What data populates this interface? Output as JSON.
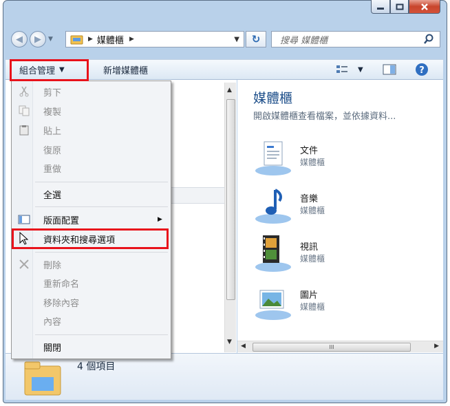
{
  "address": {
    "crumb": "媒體櫃"
  },
  "search": {
    "placeholder": "搜尋 媒體櫃"
  },
  "toolbar": {
    "organize": "組合管理",
    "new_library": "新增媒體櫃"
  },
  "menu": {
    "items": [
      {
        "label": "剪下",
        "enabled": false
      },
      {
        "label": "複製",
        "enabled": false
      },
      {
        "label": "貼上",
        "enabled": false
      },
      {
        "label": "復原",
        "enabled": false
      },
      {
        "label": "重做",
        "enabled": false
      },
      {
        "label": "全選",
        "enabled": true
      },
      {
        "label": "版面配置",
        "enabled": true,
        "submenu": true
      },
      {
        "label": "資料夾和搜尋選項",
        "enabled": true
      },
      {
        "label": "刪除",
        "enabled": false
      },
      {
        "label": "重新命名",
        "enabled": false
      },
      {
        "label": "移除內容",
        "enabled": false
      },
      {
        "label": "內容",
        "enabled": false
      },
      {
        "label": "關閉",
        "enabled": true
      }
    ]
  },
  "library": {
    "title": "媒體櫃",
    "subtitle": "開啟媒體櫃查看檔案，並依據資料...",
    "items": [
      {
        "name": "文件",
        "type": "媒體櫃",
        "icon": "documents-library-icon"
      },
      {
        "name": "音樂",
        "type": "媒體櫃",
        "icon": "music-library-icon"
      },
      {
        "name": "視訊",
        "type": "媒體櫃",
        "icon": "videos-library-icon"
      },
      {
        "name": "圖片",
        "type": "媒體櫃",
        "icon": "pictures-library-icon"
      }
    ]
  },
  "details": {
    "count": "4 個項目"
  },
  "scrollbar": {
    "hthumb_text": "III"
  },
  "colors": {
    "highlight": "#e8121b",
    "title_blue": "#1e4f8a",
    "close_red": "#c8452c"
  }
}
